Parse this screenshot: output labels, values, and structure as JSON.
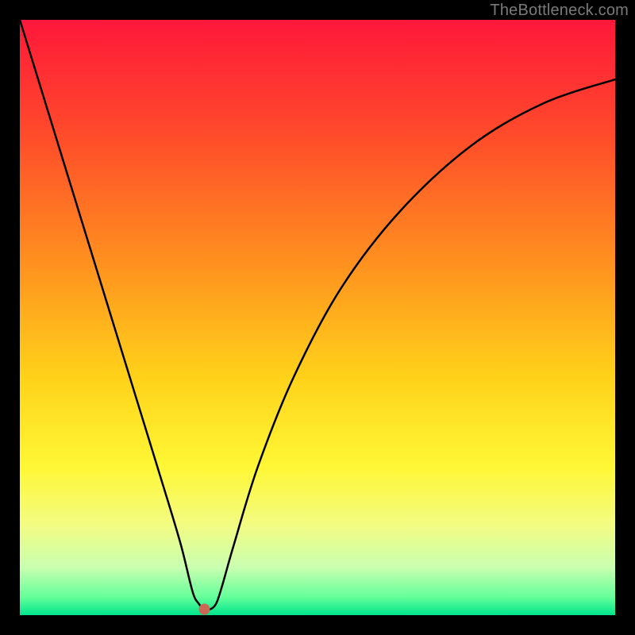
{
  "watermark": "TheBottleneck.com",
  "chart_data": {
    "type": "line",
    "title": "",
    "xlabel": "",
    "ylabel": "",
    "xlim": [
      0,
      100
    ],
    "ylim": [
      0,
      100
    ],
    "grid": false,
    "background_gradient": [
      {
        "pos": 0.0,
        "color": "#ff173a"
      },
      {
        "pos": 0.2,
        "color": "#ff4d2a"
      },
      {
        "pos": 0.4,
        "color": "#ff8e1f"
      },
      {
        "pos": 0.6,
        "color": "#ffd21a"
      },
      {
        "pos": 0.75,
        "color": "#fff735"
      },
      {
        "pos": 0.85,
        "color": "#f2fc83"
      },
      {
        "pos": 0.92,
        "color": "#c9ffb0"
      },
      {
        "pos": 0.97,
        "color": "#64ff9a"
      },
      {
        "pos": 1.0,
        "color": "#00e58c"
      }
    ],
    "series": [
      {
        "name": "bottleneck-curve",
        "x": [
          0,
          4,
          8,
          12,
          16,
          20,
          24,
          27,
          29,
          30,
          31,
          32,
          33,
          34,
          36,
          40,
          46,
          54,
          64,
          76,
          88,
          100
        ],
        "values": [
          100,
          87,
          74,
          61,
          48,
          35,
          22,
          12,
          4,
          2,
          1,
          1,
          2,
          5,
          12,
          25,
          40,
          55,
          68,
          79,
          86,
          90
        ]
      }
    ],
    "marker": {
      "x": 31,
      "y": 1,
      "color": "#cc6655",
      "radius_px": 7
    },
    "annotations": []
  }
}
